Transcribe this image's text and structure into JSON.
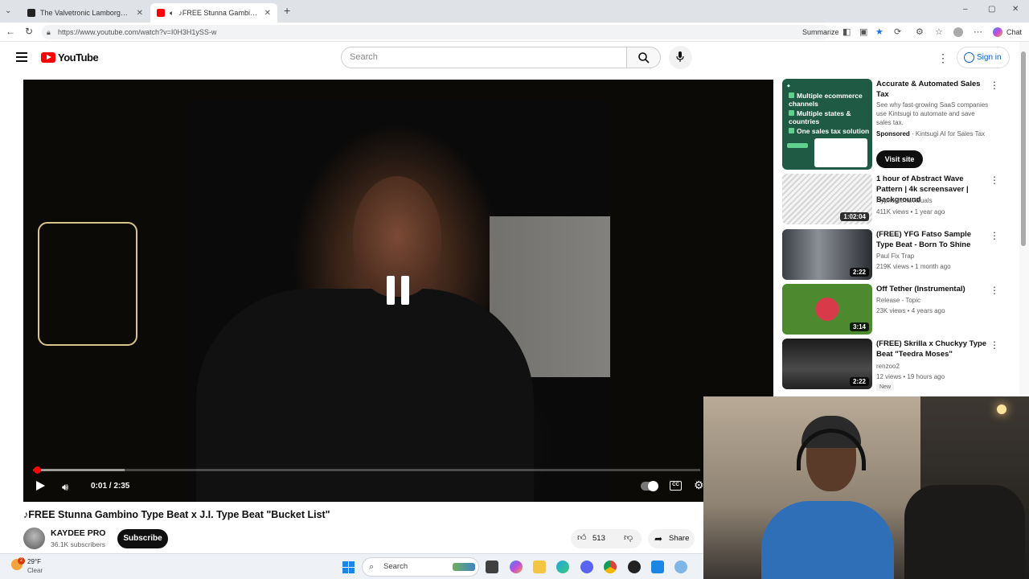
{
  "browser": {
    "tabs": [
      {
        "title": "The Valvetronic Lamborghini Revu",
        "active": false
      },
      {
        "title": "♪FREE Stunna Gambino Type B",
        "active": true
      }
    ],
    "url": "https://www.youtube.com/watch?v=I0H3H1ySS-w",
    "summarize_label": "Summarize",
    "chat_label": "Chat"
  },
  "youtube": {
    "logo_text": "YouTube",
    "search_placeholder": "Search",
    "signin_label": "Sign in"
  },
  "player": {
    "current_time": "0:01",
    "duration": "2:35",
    "time_display": "0:01 / 2:35",
    "progress_fraction": 0.0065,
    "buffered_fraction": 0.137,
    "state": "playing"
  },
  "video": {
    "title": "♪FREE Stunna Gambino Type Beat x J.I. Type Beat \"Bucket List\"",
    "channel": "KAYDEE PRO",
    "subscribers": "36.1K subscribers",
    "subscribe_label": "Subscribe",
    "likes": "513",
    "share_label": "Share"
  },
  "ad": {
    "thumb_lines": [
      "Multiple ecommerce channels",
      "Multiple states & countries",
      "One sales tax solution"
    ],
    "title": "Accurate & Automated Sales Tax",
    "description": "See why fast-growing SaaS companies use Kintsugi to automate and save sales tax.",
    "sponsored_label": "Sponsored",
    "advertiser": "Kintsugi AI for Sales Tax",
    "cta": "Visit site"
  },
  "recommendations": [
    {
      "title": "1 hour of Abstract Wave Pattern | 4k screensaver | Background",
      "channel": "HypnoRitmaVisuals",
      "meta": "411K views • 1 year ago",
      "duration": "1:02:04"
    },
    {
      "title": "(FREE) YFG Fatso Sample Type Beat - Born To Shine",
      "channel": "Paul Fix Trap",
      "meta": "219K views • 1 month ago",
      "duration": "2:22"
    },
    {
      "title": "Off Tether (Instrumental)",
      "channel": "Release - Topic",
      "meta": "23K views • 4 years ago",
      "duration": "3:14"
    },
    {
      "title": "(FREE) Skrilla x Chuckyy Type Beat \"Teedra Moses\"",
      "channel": "renzoo2",
      "meta": "12 views • 19 hours ago",
      "duration": "2:22",
      "badge": "New"
    }
  ],
  "taskbar": {
    "weather_temp": "29°F",
    "weather_condition": "Clear",
    "weather_badge": "2",
    "search_label": "Search"
  },
  "colors": {
    "youtube_red": "#ff0000",
    "link_blue": "#065fd4",
    "ad_green": "#1f5a45"
  }
}
